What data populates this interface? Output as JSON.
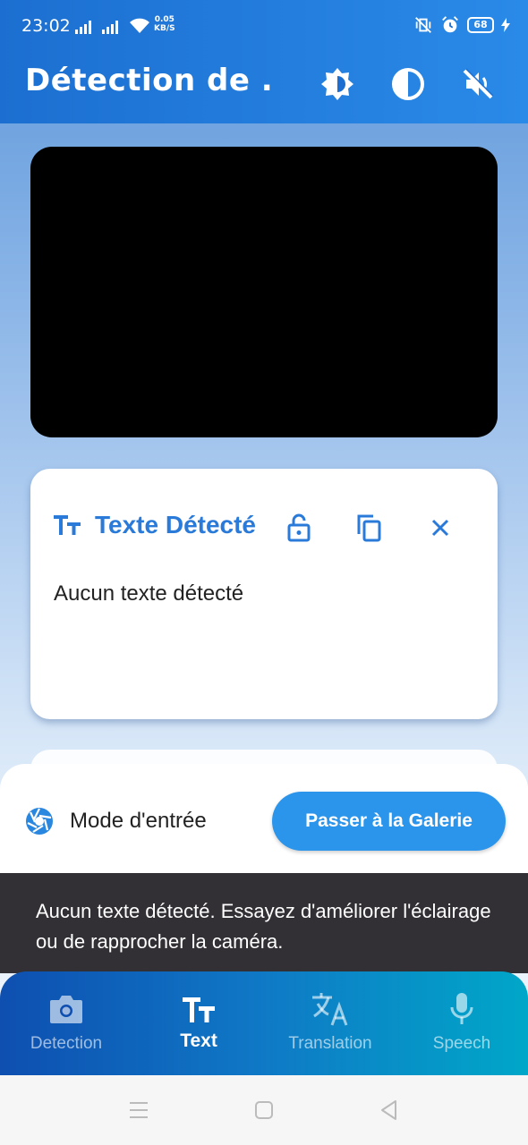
{
  "status_bar": {
    "time": "23:02",
    "net_speed_value": "0.05",
    "net_speed_unit": "KB/S",
    "battery": "68"
  },
  "app_bar": {
    "title": "Détection de ...",
    "actions": [
      "brightness-icon",
      "contrast-icon",
      "volume-off-icon"
    ]
  },
  "text_card": {
    "title": "Texte Détecté",
    "content": "Aucun texte détecté"
  },
  "input_panel": {
    "mode_label": "Mode d'entrée",
    "gallery_button": "Passer à la Galerie"
  },
  "snackbar": {
    "message": "Aucun texte détecté. Essayez d'améliorer l'éclairage ou de rapprocher la caméra."
  },
  "bottom_nav": {
    "items": [
      {
        "label": "Detection",
        "icon": "camera-icon"
      },
      {
        "label": "Text",
        "icon": "text-fields-icon",
        "active": true
      },
      {
        "label": "Translation",
        "icon": "translate-icon"
      },
      {
        "label": "Speech",
        "icon": "mic-icon"
      }
    ]
  },
  "colors": {
    "primary": "#1c6fd0",
    "accent": "#2a7ad9",
    "button": "#2b95ec",
    "snackbar": "#333035"
  }
}
